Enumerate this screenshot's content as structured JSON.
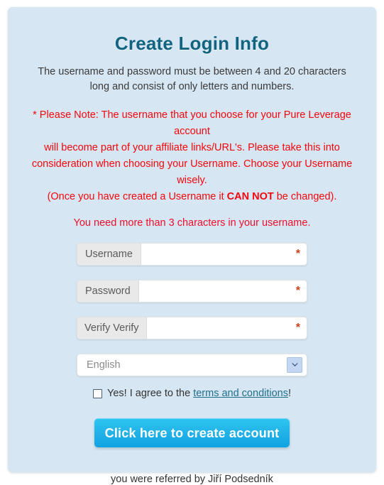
{
  "panel": {
    "title": "Create Login Info",
    "subtitle": "The username and password must be between 4 and 20 characters long and consist of only letters and numbers.",
    "note_line1": "* Please Note: The username that you choose for your Pure Leverage account",
    "note_line2": "will become part of your affiliate links/URL's. Please take this into",
    "note_line3": "consideration when choosing your Username. Choose your Username wisely.",
    "note_line4_prefix": "(Once you have created a Username it ",
    "note_line4_bold": "CAN NOT",
    "note_line4_suffix": " be changed).",
    "validation_message": "You need more than 3 characters in your username."
  },
  "form": {
    "username": {
      "label": "Username",
      "value": "",
      "placeholder": "",
      "required_marker": "*"
    },
    "password": {
      "label": "Password",
      "value": "",
      "placeholder": "",
      "required_marker": "*"
    },
    "verify": {
      "label": "Verify Verify",
      "value": "",
      "placeholder": "",
      "required_marker": "*"
    },
    "language": {
      "selected": "English"
    },
    "agree": {
      "prefix": "Yes! I agree to the ",
      "link": "terms and conditions",
      "suffix": "!"
    },
    "submit_label": "Click here to create account"
  },
  "footer": {
    "referral": "you were referred by Jiří Podsedník"
  },
  "colors": {
    "panel_background": "#d6e6f2",
    "title": "#11637f",
    "note_red": "#f5060c",
    "validation_red": "#ef0d2b",
    "required_star": "#cc4016",
    "link": "#1f6f8b",
    "button_top": "#2ec6f0",
    "button_bottom": "#0fa2e0"
  }
}
